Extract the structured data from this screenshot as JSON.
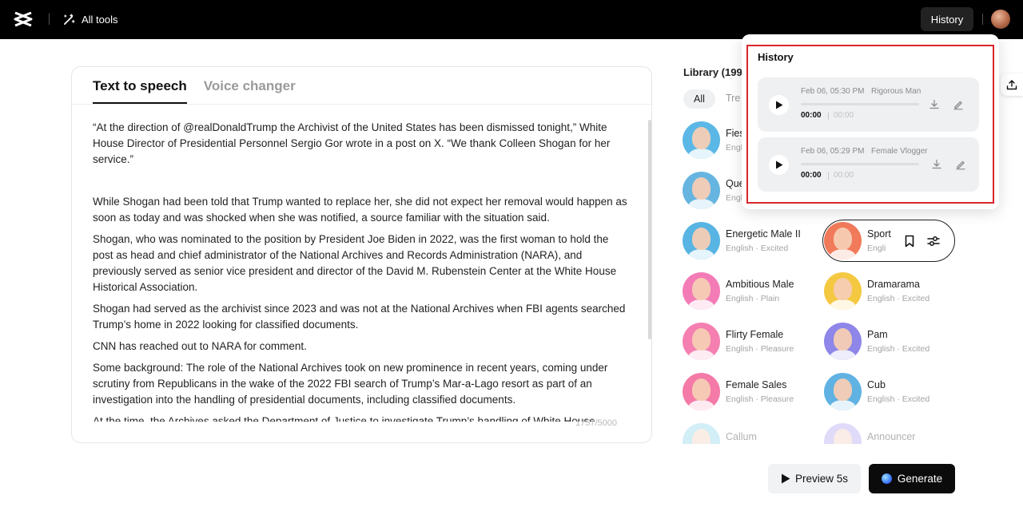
{
  "topbar": {
    "all_tools_label": "All tools",
    "history_button_label": "History"
  },
  "editor": {
    "tabs": [
      {
        "label": "Text to speech",
        "active": true
      },
      {
        "label": "Voice changer",
        "active": false
      }
    ],
    "paragraphs": [
      "“At the direction of @realDonaldTrump the Archivist of the United States has been dismissed tonight,” White House Director of Presidential Personnel Sergio Gor wrote in a post on X. “We thank Colleen Shogan for her service.”",
      "While Shogan had been told that Trump wanted to replace her, she did not expect her removal would happen as soon as today and was shocked when she was notified, a source familiar with the situation said.",
      "Shogan, who was nominated to the position by President Joe Biden in 2022, was the first woman to hold the post as head and chief administrator of the National Archives and Records Administration (NARA), and previously served as senior vice president and director of the David M. Rubenstein Center at the White House Historical Association.",
      "Shogan had served as the archivist since 2023 and was not at the National Archives when FBI agents searched Trump’s home in 2022 looking for classified documents.",
      "CNN has reached out to NARA for comment.",
      "Some background: The role of the National Archives took on new prominence in recent years, coming under scrutiny from Republicans in the wake of the 2022 FBI search of Trump’s Mar-a-Lago resort as part of an investigation into the handling of presidential documents, including classified documents.",
      "At the time, the Archives asked the Department of Justice to investigate Trump’s handling of White House"
    ],
    "char_count": "1757/5000"
  },
  "library": {
    "title": "Library (199)",
    "chips": [
      "All",
      "Tre"
    ],
    "voices": [
      {
        "name": "Fies",
        "meta": "Engli"
      },
      {
        "name": "Que",
        "meta": "Engl"
      },
      {
        "name": "Energetic Male II",
        "meta": "English · Excited"
      },
      {
        "name": "Sport",
        "meta": "Engli"
      },
      {
        "name": "Ambitious Male",
        "meta": "English · Plain"
      },
      {
        "name": "Dramarama",
        "meta": "English · Excited"
      },
      {
        "name": "Flirty Female",
        "meta": "English · Pleasure"
      },
      {
        "name": "Pam",
        "meta": "English · Excited"
      },
      {
        "name": "Female Sales",
        "meta": "English · Pleasure"
      },
      {
        "name": "Cub",
        "meta": "English · Excited"
      },
      {
        "name": "Callum",
        "meta": ""
      },
      {
        "name": "Announcer",
        "meta": ""
      }
    ]
  },
  "actions": {
    "preview_label": "Preview 5s",
    "generate_label": "Generate"
  },
  "history": {
    "title": "History",
    "items": [
      {
        "date": "Feb 06, 05:30 PM",
        "voice": "Rigorous Man",
        "current": "00:00",
        "duration": "00:00"
      },
      {
        "date": "Feb 06, 05:29 PM",
        "voice": "Female Vlogger",
        "current": "00:00",
        "duration": "00:00"
      }
    ]
  },
  "colors": {
    "topbar": "#000000",
    "highlight": "#d9262c",
    "generate": "#0b0b0b"
  }
}
